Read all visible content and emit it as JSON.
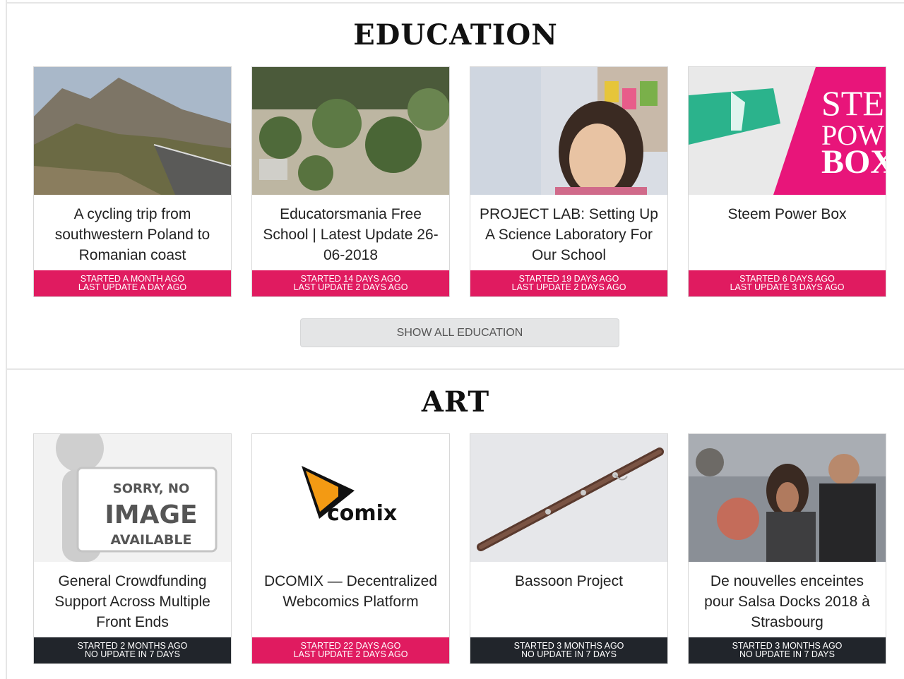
{
  "sections": {
    "education": {
      "title": "EDUCATION",
      "show_all_label": "SHOW ALL EDUCATION",
      "cards": [
        {
          "title": "A cycling trip from southwestern Poland to Romanian coast",
          "started": "STARTED A MONTH AGO",
          "update": "LAST UPDATE A DAY AGO",
          "status": "active"
        },
        {
          "title": "Educatorsmania Free School | Latest Update 26-06-2018",
          "started": "STARTED 14 DAYS AGO",
          "update": "LAST UPDATE 2 DAYS AGO",
          "status": "active"
        },
        {
          "title": "PROJECT LAB: Setting Up A Science Laboratory For Our School",
          "started": "STARTED 19 DAYS AGO",
          "update": "LAST UPDATE 2 DAYS AGO",
          "status": "active"
        },
        {
          "title": "Steem Power Box",
          "started": "STARTED 6 DAYS AGO",
          "update": "LAST UPDATE 3 DAYS AGO",
          "status": "active",
          "image_text": [
            "STE",
            "POW",
            "BOX"
          ]
        }
      ]
    },
    "art": {
      "title": "ART",
      "cards": [
        {
          "title": "General Crowdfunding Support Across Multiple Front Ends",
          "started": "STARTED 2 MONTHS AGO",
          "update": "NO UPDATE IN 7 DAYS",
          "status": "inactive",
          "image_text": [
            "SORRY, NO",
            "IMAGE",
            "AVAILABLE"
          ]
        },
        {
          "title": "DCOMIX — Decentralized Webcomics Platform",
          "started": "STARTED 22 DAYS AGO",
          "update": "LAST UPDATE 2 DAYS AGO",
          "status": "active",
          "image_text": [
            "comix"
          ]
        },
        {
          "title": "Bassoon Project",
          "started": "STARTED 3 MONTHS AGO",
          "update": "NO UPDATE IN 7 DAYS",
          "status": "inactive"
        },
        {
          "title": "De nouvelles enceintes pour Salsa Docks 2018 à Strasbourg",
          "started": "STARTED 3 MONTHS AGO",
          "update": "NO UPDATE IN 7 DAYS",
          "status": "inactive"
        }
      ]
    }
  },
  "colors": {
    "active_footer": "#e01b60",
    "inactive_footer": "#21252b",
    "button_bg": "#e4e5e6"
  }
}
